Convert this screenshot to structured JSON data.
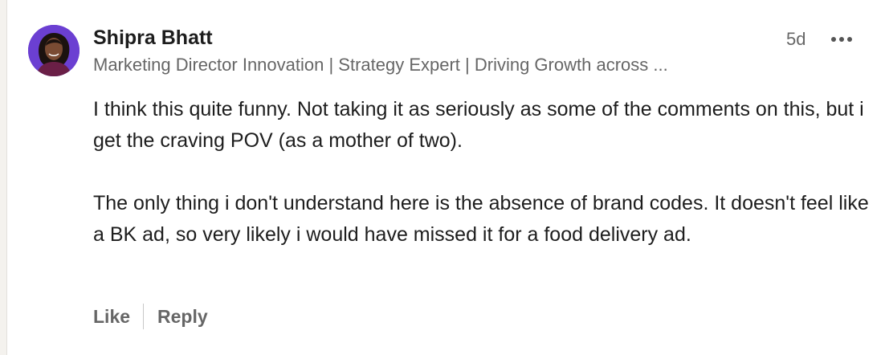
{
  "comment": {
    "author": {
      "name": "Shipra Bhatt",
      "headline": "Marketing Director Innovation | Strategy Expert | Driving Growth across ..."
    },
    "timestamp": "5d",
    "more_icon": "more-horizontal-icon",
    "paragraphs": [
      "I think this quite funny. Not taking it as seriously as some of the comments on this, but i get the craving POV (as a mother of two).",
      "The only thing i don't understand here is the absence of brand codes. It doesn't feel like a BK ad, so very likely i would have missed it for a food delivery ad."
    ],
    "actions": {
      "like_label": "Like",
      "reply_label": "Reply"
    }
  },
  "colors": {
    "avatar_background": "#6b3fd2",
    "text_primary": "#1d1d1d",
    "text_secondary": "#666666"
  }
}
